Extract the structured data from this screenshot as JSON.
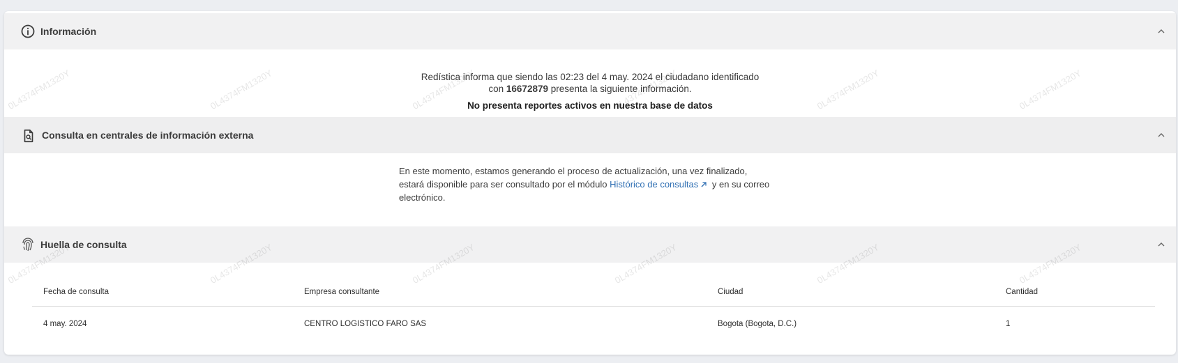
{
  "sections": {
    "info": {
      "title": "Información",
      "icon": "info-icon",
      "line1": "Redística informa que siendo las 02:23 del 4 may. 2024 el ciudadano identificado",
      "line2_prefix": "con ",
      "id_number": "16672879",
      "line2_suffix": " presenta la siguiente información.",
      "status": "No presenta reportes activos en nuestra base de datos"
    },
    "central": {
      "title": "Consulta en centrales de información externa",
      "icon": "document-search-icon",
      "text_line1": "En este momento, estamos generando el proceso de actualización, una vez finalizado,",
      "text_line2_prefix": "estará disponible para ser consultado por el módulo ",
      "link_label": "Histórico de consultas",
      "text_line2_suffix": " y en su correo",
      "text_line3": "electrónico."
    },
    "huella": {
      "title": "Huella de consulta",
      "icon": "fingerprint-icon",
      "columns": [
        "Fecha de consulta",
        "Empresa consultante",
        "Ciudad",
        "Cantidad"
      ],
      "rows": [
        [
          "4 may. 2024",
          "CENTRO LOGISTICO FARO SAS",
          "Bogota (Bogota, D.C.)",
          "1"
        ]
      ]
    }
  },
  "watermark": "0L4374FM1320Y",
  "colors": {
    "link": "#2f6fb3",
    "header_bg": "#f1f1f2",
    "page_bg": "#eceef2"
  }
}
